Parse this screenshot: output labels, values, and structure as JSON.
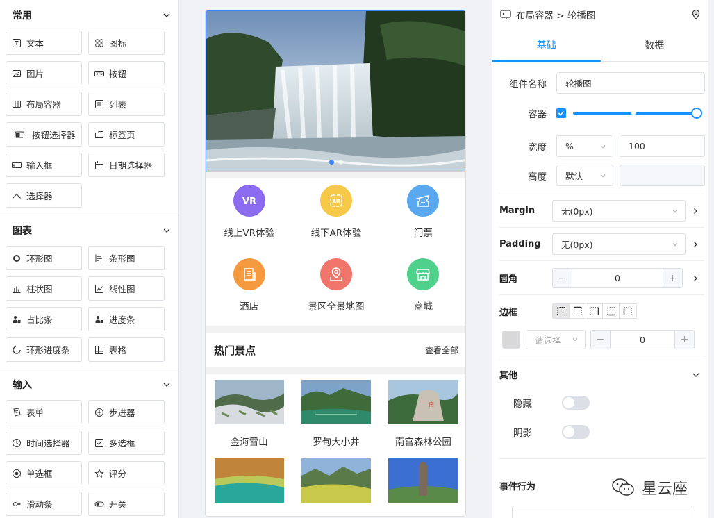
{
  "left": {
    "sections": [
      {
        "title": "常用",
        "items": [
          {
            "label": "文本",
            "icon": "text-icon"
          },
          {
            "label": "图标",
            "icon": "icon-grid-icon"
          },
          {
            "label": "图片",
            "icon": "image-icon"
          },
          {
            "label": "按钮",
            "icon": "button-icon"
          },
          {
            "label": "布局容器",
            "icon": "layout-icon"
          },
          {
            "label": "列表",
            "icon": "list-icon"
          },
          {
            "label": "按钮选择器",
            "icon": "button-selector-icon"
          },
          {
            "label": "标签页",
            "icon": "tabs-icon"
          },
          {
            "label": "输入框",
            "icon": "input-icon"
          },
          {
            "label": "日期选择器",
            "icon": "calendar-icon"
          },
          {
            "label": "选择器",
            "icon": "selector-icon"
          }
        ]
      },
      {
        "title": "图表",
        "items": [
          {
            "label": "环形图",
            "icon": "ring-chart-icon"
          },
          {
            "label": "条形图",
            "icon": "bar-chart-icon"
          },
          {
            "label": "柱状图",
            "icon": "column-chart-icon"
          },
          {
            "label": "线性图",
            "icon": "line-chart-icon"
          },
          {
            "label": "占比条",
            "icon": "ratio-bar-icon"
          },
          {
            "label": "进度条",
            "icon": "progress-icon"
          },
          {
            "label": "环形进度条",
            "icon": "ring-progress-icon"
          },
          {
            "label": "表格",
            "icon": "table-icon"
          }
        ]
      },
      {
        "title": "输入",
        "items": [
          {
            "label": "表单",
            "icon": "form-icon"
          },
          {
            "label": "步进器",
            "icon": "stepper-icon"
          },
          {
            "label": "时间选择器",
            "icon": "clock-icon"
          },
          {
            "label": "多选框",
            "icon": "checkbox-icon"
          },
          {
            "label": "单选框",
            "icon": "radio-icon"
          },
          {
            "label": "评分",
            "icon": "star-icon"
          },
          {
            "label": "滑动条",
            "icon": "slider-icon"
          },
          {
            "label": "开关",
            "icon": "switch-icon"
          }
        ]
      }
    ]
  },
  "canvas": {
    "nav": [
      {
        "label": "线上VR体验",
        "color": "#8b6cf0",
        "icon": "vr-icon"
      },
      {
        "label": "线下AR体验",
        "color": "#f7c948",
        "icon": "ar-icon"
      },
      {
        "label": "门票",
        "color": "#5aa9f0",
        "icon": "ticket-icon"
      },
      {
        "label": "酒店",
        "color": "#f59a3e",
        "icon": "hotel-icon"
      },
      {
        "label": "景区全景地图",
        "color": "#f0766b",
        "icon": "map-pin-icon"
      },
      {
        "label": "商城",
        "color": "#4fd18b",
        "icon": "shop-icon"
      }
    ],
    "hot": {
      "title": "热门景点",
      "more": "查看全部"
    },
    "spots": [
      {
        "label": "金海雪山"
      },
      {
        "label": "罗甸大小井"
      },
      {
        "label": "南宫森林公园"
      },
      {
        "label": ""
      },
      {
        "label": ""
      },
      {
        "label": ""
      }
    ]
  },
  "right": {
    "breadcrumb": "布局容器 > 轮播图",
    "tabs": [
      "基础",
      "数据"
    ],
    "component_name_label": "组件名称",
    "component_name_value": "轮播图",
    "container_label": "容器",
    "width_label": "宽度",
    "width_unit": "%",
    "width_value": "100",
    "height_label": "高度",
    "height_mode": "默认",
    "margin_label": "Margin",
    "margin_value": "无(0px)",
    "padding_label": "Padding",
    "padding_value": "无(0px)",
    "radius_label": "圆角",
    "radius_value": "0",
    "border_label": "边框",
    "border_style_placeholder": "请选择",
    "border_width_value": "0",
    "other_label": "其他",
    "hide_label": "隐藏",
    "shadow_label": "阴影",
    "event_label": "事件行为",
    "watermark": "星云座",
    "accent": "#1890ff"
  }
}
